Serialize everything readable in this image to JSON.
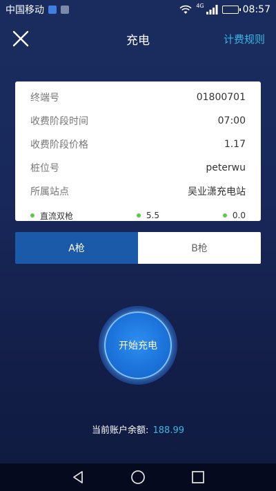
{
  "status_bar": {
    "carrier": "中国移动",
    "network": "4G",
    "time": "08:57"
  },
  "header": {
    "title": "充电",
    "rules_link": "计费规则"
  },
  "info_card": {
    "rows": [
      {
        "label": "终端号",
        "value": "01800701"
      },
      {
        "label": "收费阶段时间",
        "value": "07:00"
      },
      {
        "label": "收费阶段价格",
        "value": "1.17"
      },
      {
        "label": "桩位号",
        "value": "peterwu"
      },
      {
        "label": "所属站点",
        "value": "吴业潇充电站"
      }
    ],
    "footer": [
      {
        "text": "直流双枪",
        "dot_color": "#5dc84a"
      },
      {
        "text": "5.5",
        "dot_color": "#5dc84a"
      },
      {
        "text": "0.0",
        "dot_color": "#5dc84a"
      }
    ]
  },
  "tabs": [
    {
      "label": "A枪",
      "active": true
    },
    {
      "label": "B枪",
      "active": false
    }
  ],
  "charge_button": {
    "label": "开始充电"
  },
  "balance": {
    "label": "当前账户余额:",
    "amount": "188.99"
  },
  "colors": {
    "accent": "#37b8e6",
    "tab_active": "#1a5aa8",
    "status_dot": "#5dc84a",
    "charge_button": "#1c74db"
  },
  "icons": {
    "close": "close-icon",
    "back": "back-triangle-icon",
    "home": "home-circle-icon",
    "recents": "recents-square-icon"
  }
}
